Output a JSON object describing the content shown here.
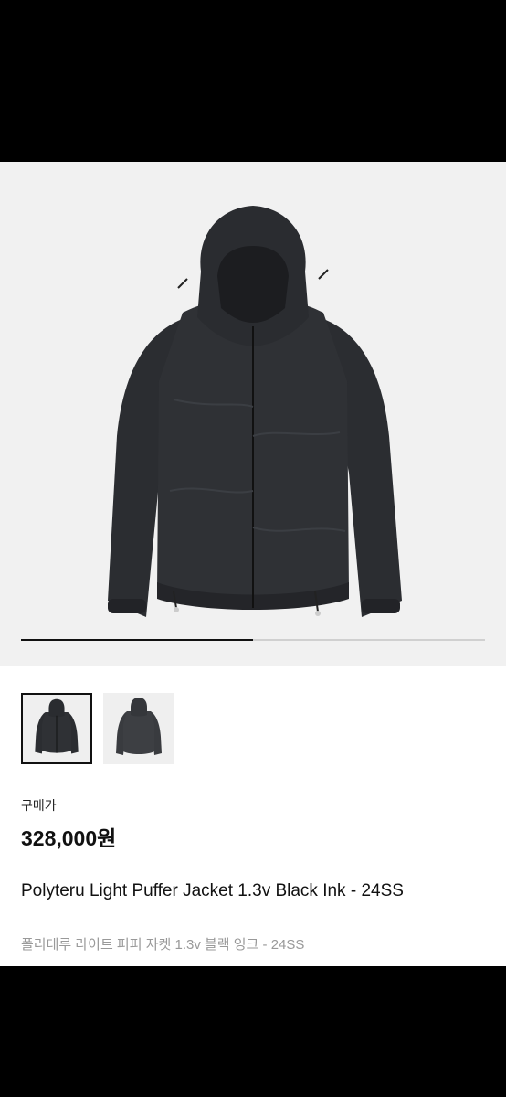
{
  "product": {
    "image": {
      "alt_icon": "black-puffer-jacket-image",
      "slide_progress": 0.5
    },
    "thumbnails": [
      {
        "name": "thumbnail-front",
        "selected": true
      },
      {
        "name": "thumbnail-back",
        "selected": false
      }
    ],
    "price_label": "구매가",
    "price": "328,000원",
    "title": "Polyteru Light Puffer Jacket 1.3v Black Ink - 24SS",
    "subtitle": "폴리테루 라이트 퍼퍼 자켓 1.3v 블랙 잉크 - 24SS"
  },
  "colors": {
    "jacket": "#2a2c30",
    "hero_bg": "#f1f1f1"
  }
}
